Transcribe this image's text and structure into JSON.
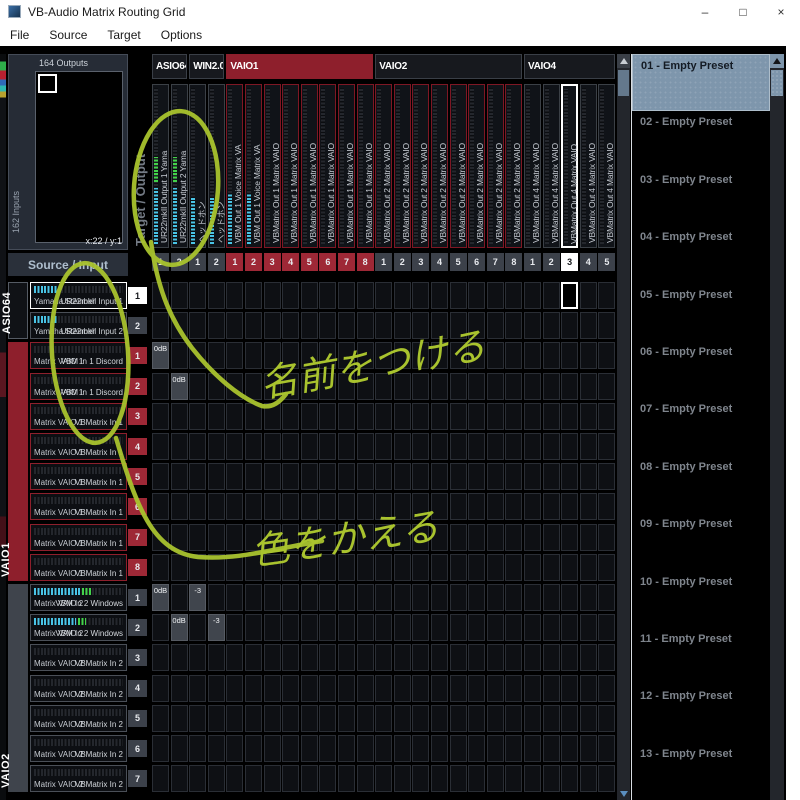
{
  "window": {
    "title": "VB-Audio Matrix Routing Grid",
    "minimize_icon": "–",
    "maximize_icon": "□",
    "close_icon": "×"
  },
  "menu": {
    "items": [
      "File",
      "Source",
      "Target",
      "Options"
    ]
  },
  "overview": {
    "outputs_label": "164 Outputs",
    "inputs_label": "162 Inputs",
    "cursor_position": "x:22 / y:1"
  },
  "headers": {
    "source": "Source / Input",
    "target": "Target / Output"
  },
  "target": {
    "groups": [
      {
        "label": "ASIO64/",
        "span": 2,
        "style": "dark"
      },
      {
        "label": "WIN2.0",
        "span": 2,
        "style": "dark"
      },
      {
        "label": "VAIO1",
        "span": 8,
        "style": "red"
      },
      {
        "label": "VAIO2",
        "span": 8,
        "style": "dark"
      },
      {
        "label": "VAIO4",
        "span": 5,
        "style": "dark"
      }
    ],
    "columns": [
      {
        "n": "1",
        "label": "UR22mkII Output 1   Yama",
        "group": "asio",
        "meter": 0.36,
        "green": 0.16,
        "badge": "dark"
      },
      {
        "n": "2",
        "label": "UR22mkII Output 2   Yama",
        "group": "asio",
        "meter": 0.36,
        "green": 0.16,
        "badge": "dark"
      },
      {
        "n": "1",
        "label": "ヘッドホン",
        "group": "win",
        "meter": 0.3,
        "green": 0,
        "badge": "dark"
      },
      {
        "n": "2",
        "label": "ヘッドホン",
        "group": "win",
        "meter": 0.3,
        "green": 0,
        "badge": "dark"
      },
      {
        "n": "1",
        "label": "VBM Out 1 Voice   Matrix VA",
        "group": "vaio1",
        "meter": 0.32,
        "green": 0,
        "badge": "red"
      },
      {
        "n": "2",
        "label": "VBM Out 1 Voice   Matrix VA",
        "group": "vaio1",
        "meter": 0.32,
        "green": 0,
        "badge": "red"
      },
      {
        "n": "3",
        "label": "VBMatrix Out 1   Matrix VAIO",
        "group": "vaio1",
        "meter": 0,
        "green": 0,
        "badge": "red"
      },
      {
        "n": "4",
        "label": "VBMatrix Out 1   Matrix VAIO",
        "group": "vaio1",
        "meter": 0,
        "green": 0,
        "badge": "red"
      },
      {
        "n": "5",
        "label": "VBMatrix Out 1   Matrix VAIO",
        "group": "vaio1",
        "meter": 0,
        "green": 0,
        "badge": "red"
      },
      {
        "n": "6",
        "label": "VBMatrix Out 1   Matrix VAIO",
        "group": "vaio1",
        "meter": 0,
        "green": 0,
        "badge": "red"
      },
      {
        "n": "7",
        "label": "VBMatrix Out 1   Matrix VAIO",
        "group": "vaio1",
        "meter": 0,
        "green": 0,
        "badge": "red"
      },
      {
        "n": "8",
        "label": "VBMatrix Out 1   Matrix VAIO",
        "group": "vaio1",
        "meter": 0,
        "green": 0,
        "badge": "red"
      },
      {
        "n": "1",
        "label": "VBMatrix Out 2   Matrix VAIO",
        "group": "vaio2",
        "meter": 0,
        "green": 0,
        "badge": "dark"
      },
      {
        "n": "2",
        "label": "VBMatrix Out 2   Matrix VAIO",
        "group": "vaio2",
        "meter": 0,
        "green": 0,
        "badge": "dark"
      },
      {
        "n": "3",
        "label": "VBMatrix Out 2   Matrix VAIO",
        "group": "vaio2",
        "meter": 0,
        "green": 0,
        "badge": "dark"
      },
      {
        "n": "4",
        "label": "VBMatrix Out 2   Matrix VAIO",
        "group": "vaio2",
        "meter": 0,
        "green": 0,
        "badge": "dark"
      },
      {
        "n": "5",
        "label": "VBMatrix Out 2   Matrix VAIO",
        "group": "vaio2",
        "meter": 0,
        "green": 0,
        "badge": "dark"
      },
      {
        "n": "6",
        "label": "VBMatrix Out 2   Matrix VAIO",
        "group": "vaio2",
        "meter": 0,
        "green": 0,
        "badge": "dark"
      },
      {
        "n": "7",
        "label": "VBMatrix Out 2   Matrix VAIO",
        "group": "vaio2",
        "meter": 0,
        "green": 0,
        "badge": "dark"
      },
      {
        "n": "8",
        "label": "VBMatrix Out 2   Matrix VAIO",
        "group": "vaio2",
        "meter": 0,
        "green": 0,
        "badge": "dark"
      },
      {
        "n": "1",
        "label": "VBMatrix Out 4   Matrix VAIO",
        "group": "vaio4",
        "meter": 0,
        "green": 0,
        "badge": "dark"
      },
      {
        "n": "2",
        "label": "VBMatrix Out 4   Matrix VAIO",
        "group": "vaio4",
        "meter": 0,
        "green": 0,
        "badge": "dark"
      },
      {
        "n": "3",
        "label": "VBMatrix Out 4   Matrix VAIO",
        "group": "vaio4",
        "meter": 0,
        "green": 0,
        "badge": "white",
        "highlighted": true
      },
      {
        "n": "4",
        "label": "VBMatrix Out 4   Matrix VAIO",
        "group": "vaio4",
        "meter": 0,
        "green": 0,
        "badge": "dark"
      },
      {
        "n": "5",
        "label": "VBMatrix Out 4   Matrix VAIO",
        "group": "vaio4",
        "meter": 0,
        "green": 0,
        "badge": "dark"
      }
    ]
  },
  "source": {
    "groups": [
      {
        "name": "ASIO64",
        "rows": 2,
        "style": "dark"
      },
      {
        "name": "VAIO1",
        "rows": 8,
        "style": "red"
      },
      {
        "name": "VAIO2",
        "rows": 7,
        "style": "gray"
      }
    ],
    "rows": [
      {
        "n": "1",
        "device": "Yamaha Steinber",
        "channel": "UR22mkII Input 1",
        "group": "asio",
        "meter": 0.26,
        "green": 0,
        "selected": true
      },
      {
        "n": "2",
        "device": "Yamaha Steinber",
        "channel": "UR22mkII Input 2",
        "group": "asio",
        "meter": 0.26,
        "green": 0
      },
      {
        "n": "1",
        "device": "Matrix VAIO 1",
        "channel": "VBM In 1 Discord",
        "group": "vaio1",
        "meter": 0,
        "green": 0
      },
      {
        "n": "2",
        "device": "Matrix VAIO 1",
        "channel": "VBM In 1 Discord",
        "group": "vaio1",
        "meter": 0,
        "green": 0
      },
      {
        "n": "3",
        "device": "Matrix VAIO 1",
        "channel": "VBMatrix In 1",
        "group": "vaio1",
        "meter": 0,
        "green": 0
      },
      {
        "n": "4",
        "device": "Matrix VAIO 1",
        "channel": "VBMatrix In 1",
        "group": "vaio1",
        "meter": 0,
        "green": 0
      },
      {
        "n": "5",
        "device": "Matrix VAIO 1",
        "channel": "VBMatrix In 1",
        "group": "vaio1",
        "meter": 0,
        "green": 0
      },
      {
        "n": "6",
        "device": "Matrix VAIO 1",
        "channel": "VBMatrix In 1",
        "group": "vaio1",
        "meter": 0,
        "green": 0
      },
      {
        "n": "7",
        "device": "Matrix VAIO 1",
        "channel": "VBMatrix In 1",
        "group": "vaio1",
        "meter": 0,
        "green": 0
      },
      {
        "n": "8",
        "device": "Matrix VAIO 1",
        "channel": "VBMatrix In 1",
        "group": "vaio1",
        "meter": 0,
        "green": 0
      },
      {
        "n": "1",
        "device": "Matrix VAIO 2",
        "channel": "VBM In 2 Windows",
        "group": "vaio2",
        "meter": 0.52,
        "green": 0.1
      },
      {
        "n": "2",
        "device": "Matrix VAIO 2",
        "channel": "VBM In 2 Windows",
        "group": "vaio2",
        "meter": 0.47,
        "green": 0.09
      },
      {
        "n": "3",
        "device": "Matrix VAIO 2",
        "channel": "VBMatrix In 2",
        "group": "vaio2",
        "meter": 0,
        "green": 0
      },
      {
        "n": "4",
        "device": "Matrix VAIO 2",
        "channel": "VBMatrix In 2",
        "group": "vaio2",
        "meter": 0,
        "green": 0
      },
      {
        "n": "5",
        "device": "Matrix VAIO 2",
        "channel": "VBMatrix In 2",
        "group": "vaio2",
        "meter": 0,
        "green": 0
      },
      {
        "n": "6",
        "device": "Matrix VAIO 2",
        "channel": "VBMatrix In 2",
        "group": "vaio2",
        "meter": 0,
        "green": 0
      },
      {
        "n": "7",
        "device": "Matrix VAIO 2",
        "channel": "VBMatrix In 2",
        "group": "vaio2",
        "meter": 0,
        "green": 0
      }
    ]
  },
  "matrix": {
    "active_points": [
      {
        "r": 2,
        "c": 0,
        "v": "0dB"
      },
      {
        "r": 3,
        "c": 1,
        "v": "0dB"
      },
      {
        "r": 10,
        "c": 0,
        "v": "0dB"
      },
      {
        "r": 10,
        "c": 2,
        "v": "-3"
      },
      {
        "r": 11,
        "c": 1,
        "v": "0dB"
      },
      {
        "r": 11,
        "c": 3,
        "v": "-3"
      }
    ],
    "selected_cell": {
      "r": 0,
      "c": 22
    }
  },
  "presets": {
    "items": [
      "01 - Empty Preset",
      "02 - Empty Preset",
      "03 - Empty Preset",
      "04 - Empty Preset",
      "05 - Empty Preset",
      "06 - Empty Preset",
      "07 - Empty Preset",
      "08 - Empty Preset",
      "09 - Empty Preset",
      "10 - Empty Preset",
      "11 - Empty Preset",
      "12 - Empty Preset",
      "13 - Empty Preset"
    ],
    "selected_index": 0
  },
  "annotations": {
    "color": "#a9c32e",
    "columns_note": "名前をつける",
    "rows_note": "色をかえる"
  }
}
